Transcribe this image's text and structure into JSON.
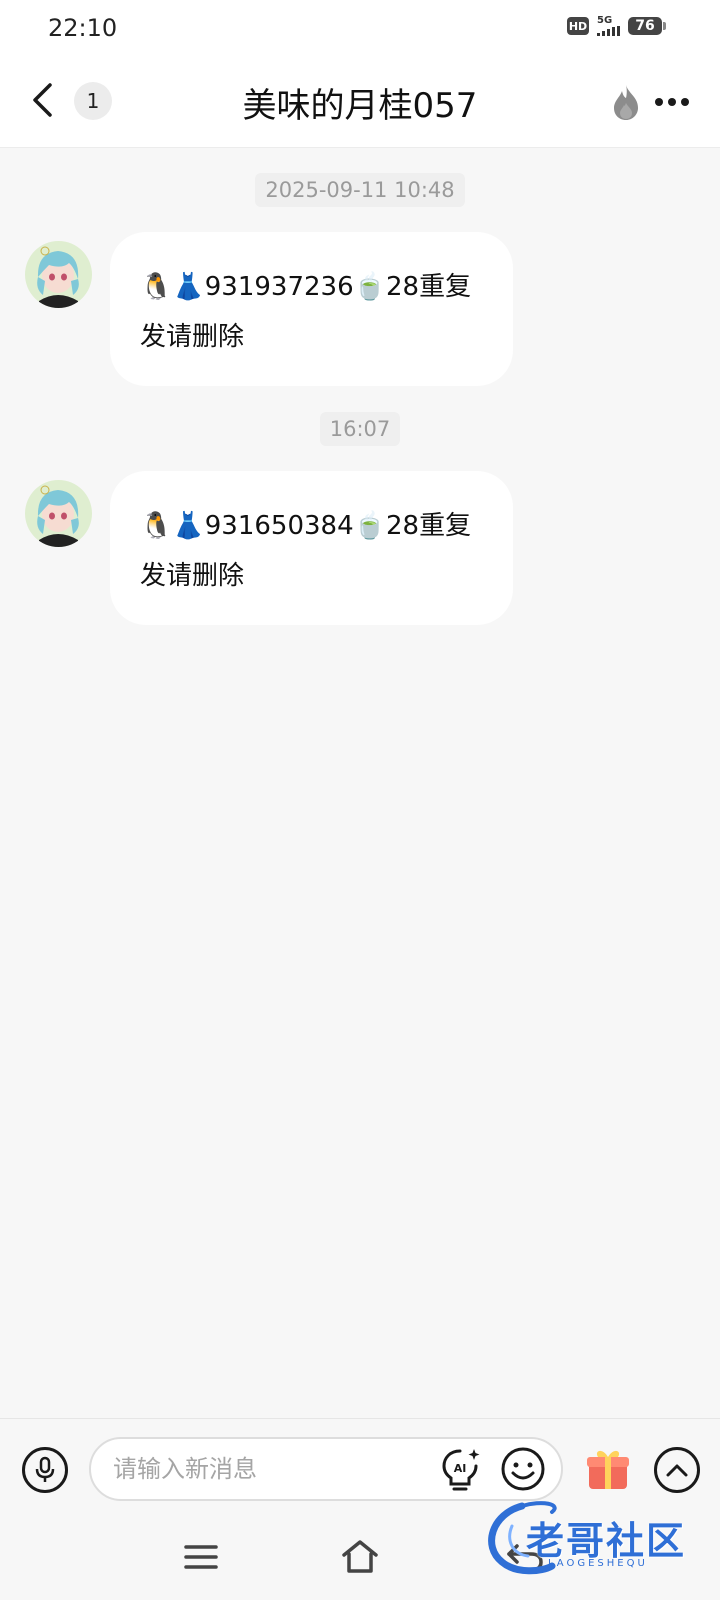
{
  "status_bar": {
    "time": "22:10",
    "hd": "HD",
    "network": "5G",
    "battery": "76"
  },
  "header": {
    "unread_count": "1",
    "title": "美味的月桂057",
    "back_icon": "chevron-left-icon",
    "fire_icon": "flame-icon",
    "more_icon": "more-horizontal-icon"
  },
  "messages": [
    {
      "timestamp": "2025-09-11 10:48",
      "emoji_prefix": "🐧👗",
      "number": "931937236",
      "emoji_mid": "🍵",
      "text_line1_tail": "28重复",
      "text_line2": "发请删除"
    },
    {
      "timestamp": "16:07",
      "emoji_prefix": "🐧👗",
      "number": "931650384",
      "emoji_mid": "🍵",
      "text_line1_tail": "28重复",
      "text_line2": "发请删除"
    }
  ],
  "input_bar": {
    "placeholder": "请输入新消息",
    "ai_label": "AI"
  },
  "watermark": {
    "title": "老哥社区",
    "subtitle": "LAOGESHEQU"
  },
  "colors": {
    "background": "#f7f7f7",
    "bubble": "#ffffff",
    "gift": "#f26b5b",
    "watermark": "#2f6fd6"
  }
}
